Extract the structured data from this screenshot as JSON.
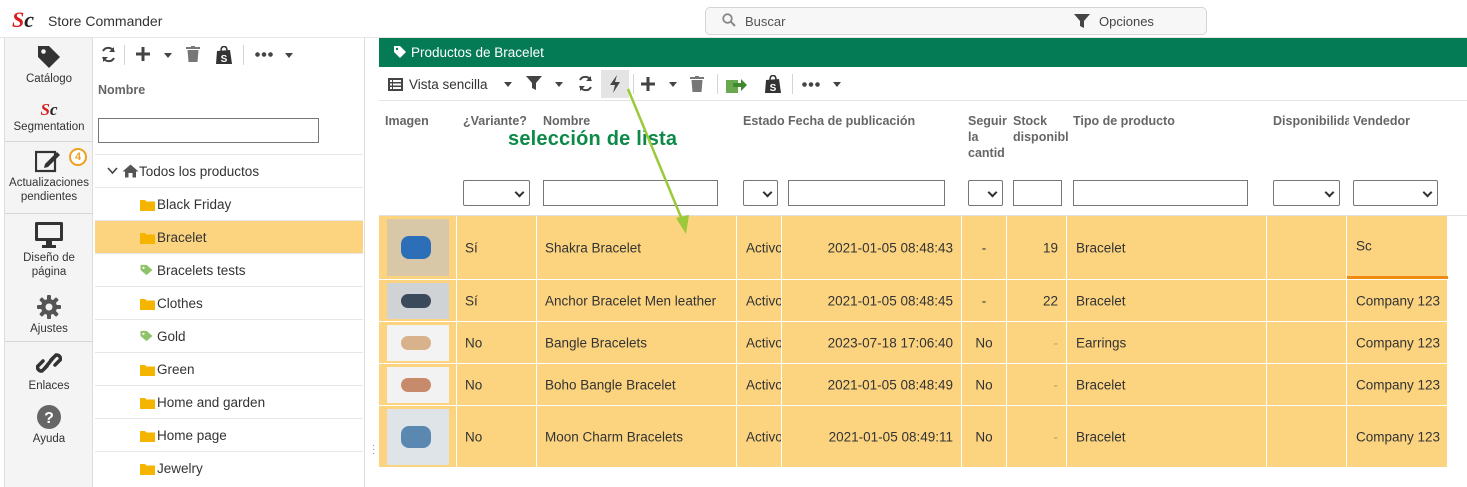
{
  "app": {
    "logo_s": "S",
    "logo_c": "c",
    "title": "Store Commander"
  },
  "search": {
    "placeholder": "Buscar",
    "options_label": "Opciones"
  },
  "nav": {
    "items": [
      {
        "label": "Catálogo",
        "icon": "tag-icon"
      },
      {
        "label": "Segmentation",
        "icon": "sc-logo-icon"
      },
      {
        "label": "Actualizaciones pendientes",
        "icon": "edit-icon",
        "badge": "4"
      },
      {
        "label": "Diseño de página",
        "icon": "monitor-icon"
      },
      {
        "label": "Ajustes",
        "icon": "gear-icon"
      },
      {
        "label": "Enlaces",
        "icon": "link-icon"
      },
      {
        "label": "Ayuda",
        "icon": "help-icon"
      }
    ]
  },
  "categories": {
    "header": "Nombre",
    "filter_value": "",
    "root": "Todos los productos",
    "items": [
      {
        "label": "Black Friday",
        "icon": "folder-icon",
        "selected": false
      },
      {
        "label": "Bracelet",
        "icon": "folder-icon",
        "selected": true
      },
      {
        "label": "Bracelets tests",
        "icon": "tag-icon",
        "selected": false
      },
      {
        "label": "Clothes",
        "icon": "folder-icon",
        "selected": false
      },
      {
        "label": "Gold",
        "icon": "tag-icon",
        "selected": false
      },
      {
        "label": "Green",
        "icon": "folder-icon",
        "selected": false
      },
      {
        "label": "Home and garden",
        "icon": "folder-icon",
        "selected": false
      },
      {
        "label": "Home page",
        "icon": "folder-icon",
        "selected": false
      },
      {
        "label": "Jewelry",
        "icon": "folder-icon",
        "selected": false
      }
    ]
  },
  "main": {
    "title": "Productos de Bracelet",
    "view_label": "Vista sencilla",
    "annotation": "selección de lista",
    "columns": {
      "imagen": "Imagen",
      "variante": "¿Variante?",
      "nombre": "Nombre",
      "estado": "Estado",
      "fecha": "Fecha de publicación",
      "seguir_1": "Seguir",
      "seguir_2": "la",
      "seguir_3": "cantid",
      "stock_1": "Stock",
      "stock_2": "disponibl",
      "tipo": "Tipo de producto",
      "disponibilidad": "Disponibilida",
      "vendedor": "Vendedor"
    },
    "rows": [
      {
        "variante": "Sí",
        "nombre": "Shakra Bracelet",
        "estado": "Activo",
        "fecha": "2021-01-05 08:48:43",
        "seguir": "-",
        "stock": "19",
        "tipo": "Bracelet",
        "disponibilidad": "",
        "vendedor": "Sc"
      },
      {
        "variante": "Sí",
        "nombre": "Anchor Bracelet Men leather",
        "estado": "Activo",
        "fecha": "2021-01-05 08:48:45",
        "seguir": "-",
        "stock": "22",
        "tipo": "Bracelet",
        "disponibilidad": "",
        "vendedor": "Company 123"
      },
      {
        "variante": "No",
        "nombre": "Bangle Bracelets",
        "estado": "Activo",
        "fecha": "2023-07-18 17:06:40",
        "seguir": "No",
        "stock": "-",
        "tipo": "Earrings",
        "disponibilidad": "",
        "vendedor": "Company 123"
      },
      {
        "variante": "No",
        "nombre": "Boho Bangle Bracelet",
        "estado": "Activo",
        "fecha": "2021-01-05 08:48:49",
        "seguir": "No",
        "stock": "-",
        "tipo": "Bracelet",
        "disponibilidad": "",
        "vendedor": "Company 123"
      },
      {
        "variante": "No",
        "nombre": "Moon Charm Bracelets",
        "estado": "Activo",
        "fecha": "2021-01-05 08:49:11",
        "seguir": "No",
        "stock": "-",
        "tipo": "Bracelet",
        "disponibilidad": "",
        "vendedor": "Company 123"
      }
    ]
  },
  "colors": {
    "brand_red": "#d81c1c",
    "header_green": "#047a55",
    "selection": "#fcd480",
    "annotation": "#0d8a4a",
    "badge": "#f0a020"
  }
}
